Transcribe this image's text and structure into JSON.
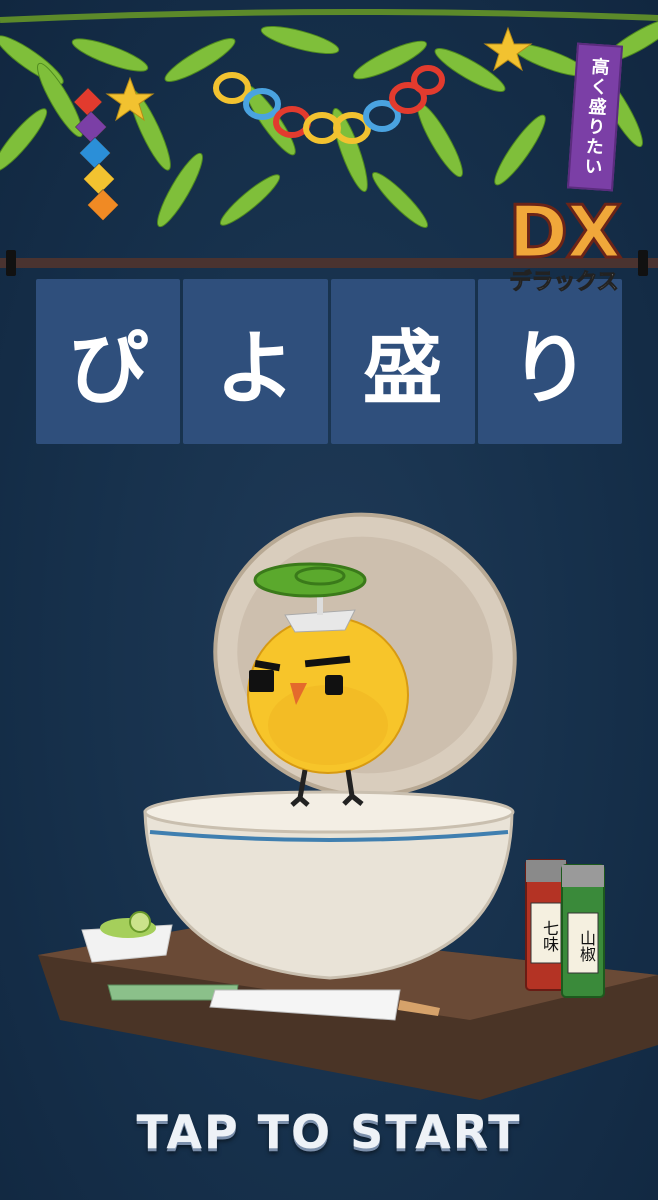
{
  "title": {
    "banner_chars": [
      "ぴ",
      "よ",
      "盛",
      "り"
    ],
    "dx_label": "DX",
    "dx_subtitle": "デラックス",
    "tanzaku_text": "高く盛りたい"
  },
  "scene": {
    "shichimi_label": "七味",
    "sansho_label": "山椒"
  },
  "start_prompt": "TAP TO START",
  "colors": {
    "background": "#16304b",
    "noren": "#2f4f7c",
    "chick": "#f7c52a",
    "dx": "#f0a73a",
    "tanzaku": "#7b3fa6"
  }
}
